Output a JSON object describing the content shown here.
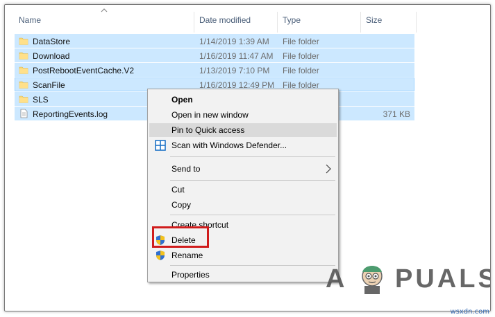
{
  "columns": {
    "name": "Name",
    "date_modified": "Date modified",
    "type": "Type",
    "size": "Size"
  },
  "files": [
    {
      "name": "DataStore",
      "date": "1/14/2019 1:39 AM",
      "type": "File folder",
      "size": "",
      "icon": "folder-icon"
    },
    {
      "name": "Download",
      "date": "1/16/2019 11:47 AM",
      "type": "File folder",
      "size": "",
      "icon": "folder-icon"
    },
    {
      "name": "PostRebootEventCache.V2",
      "date": "1/13/2019 7:10 PM",
      "type": "File folder",
      "size": "",
      "icon": "folder-icon"
    },
    {
      "name": "ScanFile",
      "date": "1/16/2019 12:49 PM",
      "type": "File folder",
      "size": "",
      "icon": "folder-icon"
    },
    {
      "name": "SLS",
      "date": "",
      "type": "",
      "size": "",
      "icon": "folder-icon"
    },
    {
      "name": "ReportingEvents.log",
      "date": "",
      "type": "",
      "size": "371 KB",
      "icon": "text-file-icon"
    }
  ],
  "context_menu": {
    "open": "Open",
    "open_new_window": "Open in new window",
    "pin_quick_access": "Pin to Quick access",
    "scan_defender": "Scan with Windows Defender...",
    "send_to": "Send to",
    "cut": "Cut",
    "copy": "Copy",
    "create_shortcut": "Create shortcut",
    "delete": "Delete",
    "rename": "Rename",
    "properties": "Properties",
    "highlighted_item": "Pin to Quick access",
    "annotated_item": "Delete"
  },
  "colors": {
    "selection": "#cce8ff",
    "menu_bg": "#f2f2f2",
    "menu_highlight": "#dadada",
    "annotation_red": "#d01c1c",
    "folder_yellow": "#f8d775"
  },
  "watermark": {
    "brand_a": "A",
    "brand_rest": "PUALS"
  },
  "credit": "wsxdn.com"
}
